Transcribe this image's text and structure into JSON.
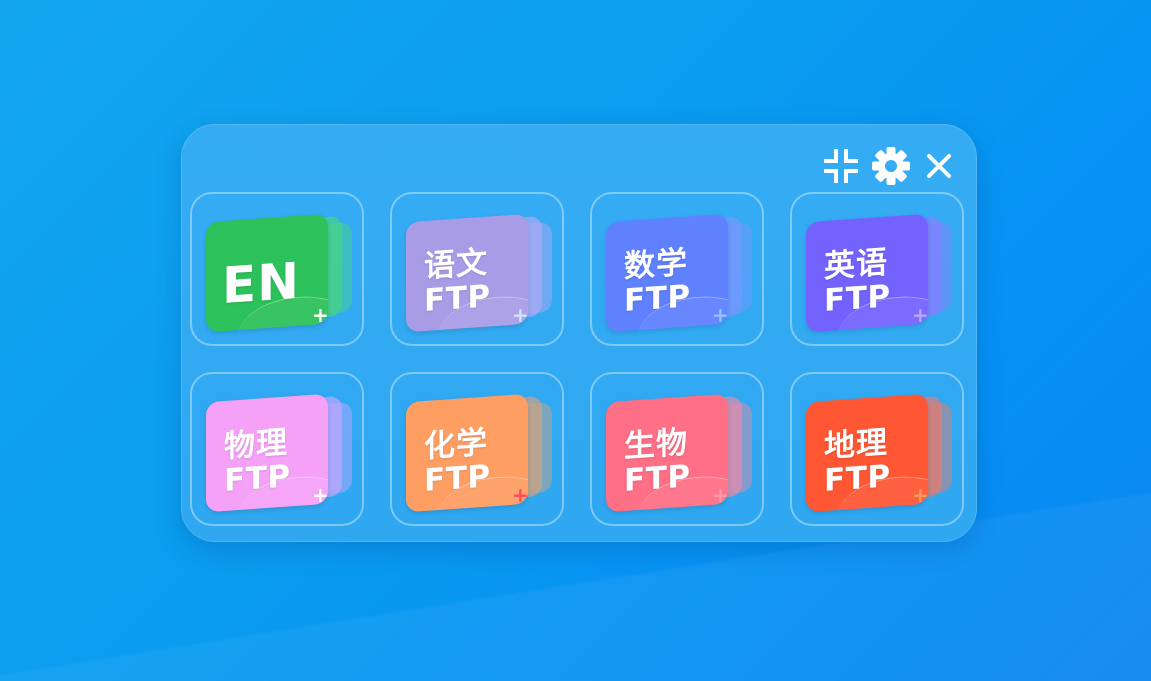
{
  "toolbar": {
    "compact_icon": "collapse-icon",
    "settings_icon": "gear-icon",
    "close_icon": "close-icon"
  },
  "tiles": [
    {
      "name": "en",
      "title": "EN",
      "subtitle": "",
      "colors": {
        "front": "#2cc15a",
        "back": "#4cd67e",
        "plus": "#ffffff"
      }
    },
    {
      "name": "chinese",
      "title": "语文",
      "subtitle": "FTP",
      "colors": {
        "front": "#a89ce6",
        "back": "#b7a9f2",
        "plus": "#c9e6ff"
      }
    },
    {
      "name": "math",
      "title": "数学",
      "subtitle": "FTP",
      "colors": {
        "front": "#5f80ff",
        "back": "#7a97ff",
        "plus": "#8fc3ff"
      }
    },
    {
      "name": "english",
      "title": "英语",
      "subtitle": "FTP",
      "colors": {
        "front": "#7462ff",
        "back": "#8b7dff",
        "plus": "#b9a7ff"
      }
    },
    {
      "name": "physics",
      "title": "物理",
      "subtitle": "FTP",
      "colors": {
        "front": "#f5a1f7",
        "back": "#c9a6ff",
        "plus": "#ffffff"
      }
    },
    {
      "name": "chemistry",
      "title": "化学",
      "subtitle": "FTP",
      "colors": {
        "front": "#ff9e63",
        "back": "#d8a37a",
        "plus": "#ff4a5c"
      }
    },
    {
      "name": "biology",
      "title": "生物",
      "subtitle": "FTP",
      "colors": {
        "front": "#ff6f86",
        "back": "#f08aa4",
        "plus": "#ff9aa8"
      }
    },
    {
      "name": "geography",
      "title": "地理",
      "subtitle": "FTP",
      "colors": {
        "front": "#ff5733",
        "back": "#f07a66",
        "plus": "#ff9a5c"
      }
    }
  ]
}
